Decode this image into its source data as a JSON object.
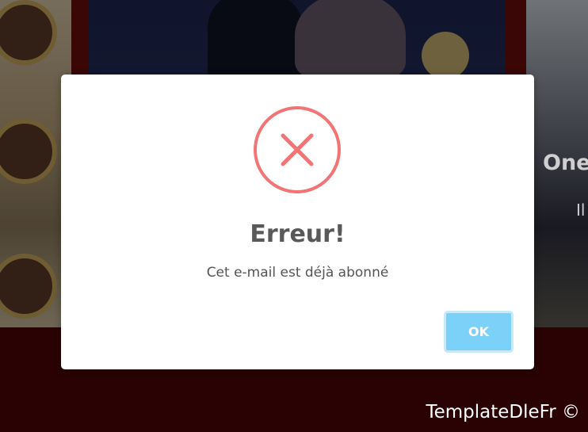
{
  "background": {
    "peek_title": "One",
    "peek_subtitle": "Il"
  },
  "dialog": {
    "icon": "error-x-icon",
    "title": "Erreur!",
    "message": "Cet e-mail est déjà abonné",
    "ok_label": "OK"
  },
  "watermark": "TemplateDleFr ©",
  "colors": {
    "error_ring": "#f27474",
    "ok_button": "#7cd1f9",
    "page_background": "#2a0204"
  }
}
